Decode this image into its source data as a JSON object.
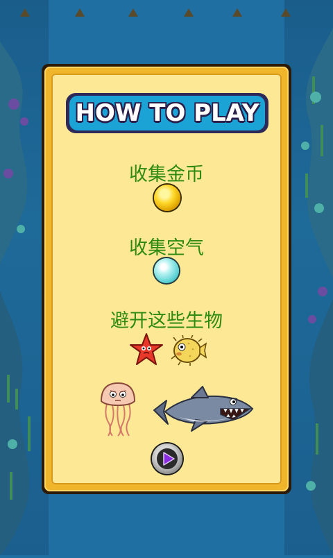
{
  "title": "HOW TO PLAY",
  "sections": [
    {
      "label": "收集金币",
      "icon": "gold-coin-icon"
    },
    {
      "label": "收集空气",
      "icon": "air-bubble-icon"
    },
    {
      "label": "避开这些生物",
      "icon": "creatures-icons"
    }
  ],
  "creatures": [
    "starfish-icon",
    "pufferfish-icon",
    "jellyfish-icon",
    "shark-icon"
  ],
  "play_button": {
    "icon": "play-icon",
    "accent": "#8a2be2"
  },
  "colors": {
    "background": "#1f6fa3",
    "panel": "#fde995",
    "frame": "#f0b52a",
    "heading_text": "#2e8a12",
    "title_bg": "#1ba3d6"
  }
}
